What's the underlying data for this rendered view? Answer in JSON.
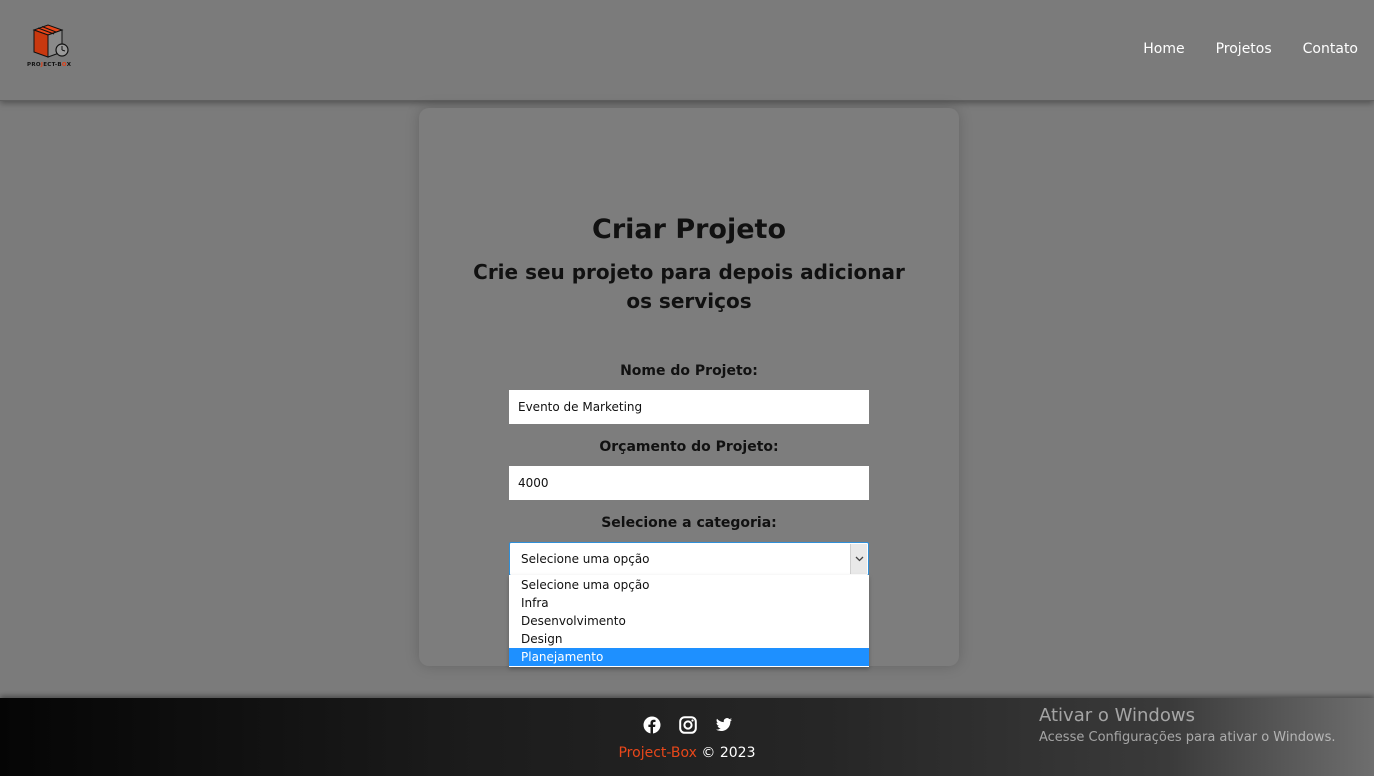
{
  "header": {
    "logo_text_parts": [
      "PRO",
      "J",
      "ECT-B",
      "O",
      "X"
    ],
    "logo_alt": "Project-Box",
    "nav": [
      {
        "label": "Home"
      },
      {
        "label": "Projetos"
      },
      {
        "label": "Contato"
      }
    ]
  },
  "form": {
    "title": "Criar Projeto",
    "subtitle": "Crie seu projeto para depois adicionar os serviços",
    "name_label": "Nome do Projeto:",
    "name_value": "Evento de Marketing",
    "budget_label": "Orçamento do Projeto:",
    "budget_value": "4000",
    "category_label": "Selecione a categoria:",
    "category_selected": "Selecione uma opção",
    "category_options": [
      "Selecione uma opção",
      "Infra",
      "Desenvolvimento",
      "Design",
      "Planejamento"
    ],
    "highlighted_option": "Planejamento"
  },
  "footer": {
    "social_icons": [
      "facebook-icon",
      "instagram-icon",
      "twitter-icon"
    ],
    "brand": "Project-Box",
    "copyright": "© 2023"
  },
  "watermark": {
    "line1": "Ativar o Windows",
    "line2": "Acesse Configurações para ativar o Windows."
  },
  "colors": {
    "accent": "#e8471a",
    "highlight": "#1e90ff",
    "background": "#7b7b7b"
  }
}
